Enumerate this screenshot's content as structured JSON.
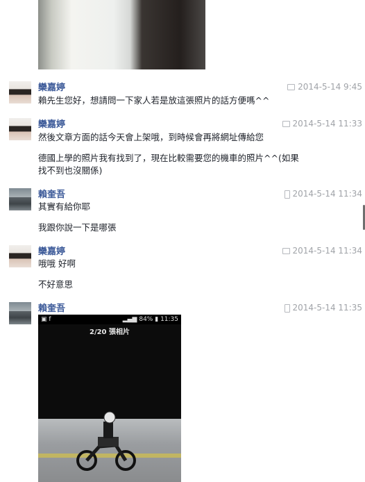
{
  "messages": [
    {
      "sender": "欒嘉婷",
      "timestamp": "2014-5-14 9:45",
      "source": "chat-icon",
      "lines": [
        "賴先生您好，想請問一下家人若是放這張照片的話方便嗎^^"
      ]
    },
    {
      "sender": "欒嘉婷",
      "timestamp": "2014-5-14 11:33",
      "source": "chat-icon",
      "lines": [
        "然後文章方面的話今天會上架哦，到時候會再將網址傳給您",
        "德國上學的照片我有找到了，現在比較需要您的機車的照片^^(如果",
        "找不到也沒關係)"
      ]
    },
    {
      "sender": "賴奎吾",
      "timestamp": "2014-5-14 11:34",
      "source": "mobile-icon",
      "lines": [
        "其實有給你耶",
        "我跟你說一下是哪張"
      ]
    },
    {
      "sender": "欒嘉婷",
      "timestamp": "2014-5-14 11:34",
      "source": "chat-icon",
      "lines": [
        "哦哦 好啊",
        "不好意思"
      ]
    },
    {
      "sender": "賴奎吾",
      "timestamp": "2014-5-14 11:35",
      "source": "mobile-icon",
      "lines": []
    }
  ],
  "attachment": {
    "status_battery": "84%",
    "status_time": "11:35",
    "album_title": "2/20 張相片"
  },
  "colors": {
    "sender_name": "#3b5998",
    "timestamp": "#a0a3a8",
    "text": "#1d2129"
  }
}
